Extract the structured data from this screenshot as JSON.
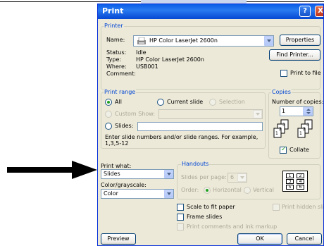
{
  "window": {
    "title": "Print",
    "help_glyph": "?",
    "close_glyph": "X"
  },
  "printer": {
    "section": "Printer",
    "name_label": "Name:",
    "name_value": "HP Color LaserJet 2600n",
    "properties_button": "Properties",
    "find_printer_button": "Find Printer...",
    "status_label": "Status:",
    "status_value": "Idle",
    "type_label": "Type:",
    "type_value": "HP Color LaserJet 2600n",
    "where_label": "Where:",
    "where_value": "USB001",
    "comment_label": "Comment:",
    "print_to_file_label": "Print to file"
  },
  "print_range": {
    "section": "Print range",
    "all_label": "All",
    "current_slide_label": "Current slide",
    "selection_label": "Selection",
    "custom_show_label": "Custom Show:",
    "slides_label": "Slides:",
    "hint": "Enter slide numbers and/or slide ranges. For example, 1,3,5-12"
  },
  "copies": {
    "section": "Copies",
    "number_label": "Number of copies:",
    "number_value": "1",
    "collate_label": "Collate"
  },
  "print_what": {
    "label": "Print what:",
    "value": "Slides"
  },
  "color": {
    "label": "Color/grayscale:",
    "value": "Color"
  },
  "handouts": {
    "section": "Handouts",
    "slides_per_page_label": "Slides per page:",
    "slides_per_page_value": "6",
    "order_label": "Order:",
    "horizontal_label": "Horizontal",
    "vertical_label": "Vertical",
    "grid": [
      "1",
      "2",
      "3",
      "4",
      "5",
      "6"
    ]
  },
  "options": {
    "scale_label": "Scale to fit paper",
    "frame_label": "Frame slides",
    "comments_label": "Print comments and ink markup",
    "hidden_label": "Print hidden slides"
  },
  "footer": {
    "preview": "Preview",
    "ok": "OK",
    "cancel": "Cancel"
  }
}
